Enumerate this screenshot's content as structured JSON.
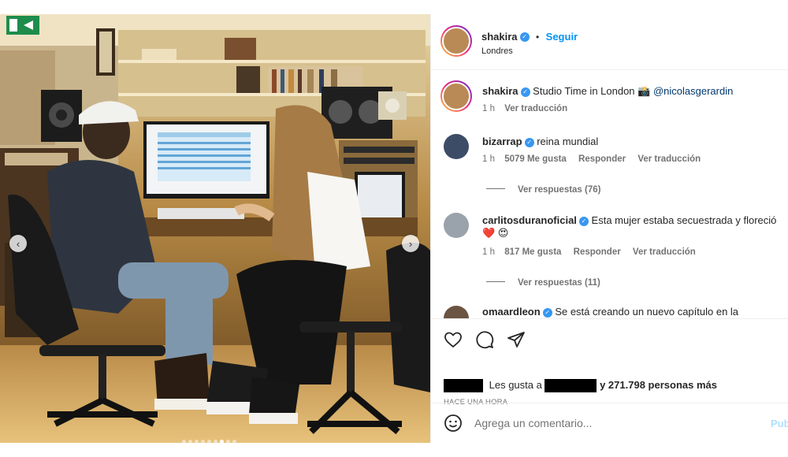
{
  "post": {
    "username": "shakira",
    "follow_separator": "•",
    "follow_label": "Seguir",
    "location": "Londres"
  },
  "carousel": {
    "prev_icon": "chevron-left-icon",
    "next_icon": "chevron-right-icon",
    "slide_count": 9,
    "active_slide": 7
  },
  "comments": [
    {
      "username": "shakira",
      "text": "Studio Time in London 📸 ",
      "mention": "@nicolasgerardin",
      "time": "1 h",
      "translate": "Ver traducción"
    },
    {
      "username": "bizarrap",
      "text": "reina mundial",
      "time": "1 h",
      "likes": "5079 Me gusta",
      "reply": "Responder",
      "translate": "Ver traducción",
      "view_replies": "Ver respuestas (76)"
    },
    {
      "username": "carlitosduranoficial",
      "text": "Esta mujer estaba secuestrada y floreció",
      "emojis": "❤️ 😍",
      "time": "1 h",
      "likes": "817 Me gusta",
      "reply": "Responder",
      "translate": "Ver traducción",
      "view_replies": "Ver respuestas (11)"
    },
    {
      "username": "omaardleon",
      "text": "Se está creando un nuevo capítulo en la"
    }
  ],
  "actions": {
    "like_icon": "heart-icon",
    "comment_icon": "comment-icon",
    "share_icon": "send-icon",
    "likes_prefix": "Les gusta a",
    "likes_suffix": "y 271.798 personas más",
    "timestamp": "HACE UNA HORA"
  },
  "add_comment": {
    "emoji_icon": "smiley-icon",
    "placeholder": "Agrega un comentario...",
    "publish_label": "Publicar"
  },
  "colors": {
    "accent": "#0095f6",
    "verified": "#3897f0",
    "muted": "#737373"
  }
}
